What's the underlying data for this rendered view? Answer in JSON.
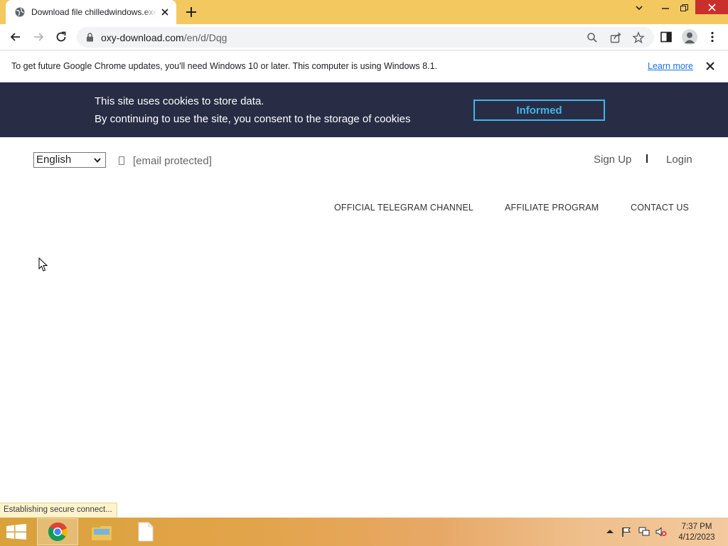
{
  "browser": {
    "tab_title": "Download file chilledwindows.exe",
    "url_host": "oxy-download.com",
    "url_path": "/en/d/Dqg"
  },
  "infobar": {
    "message": "To get future Google Chrome updates, you'll need Windows 10 or later. This computer is using Windows 8.1.",
    "link": "Learn more"
  },
  "cookie": {
    "line1": "This site uses cookies to store data.",
    "line2": "By continuing to use the site, you consent to the storage of cookies",
    "button": "Informed"
  },
  "header": {
    "language": "English",
    "email": "[email protected]",
    "signup": "Sign Up",
    "separator": "I",
    "login": "Login"
  },
  "nav": {
    "items": [
      "OFFICIAL TELEGRAM CHANNEL",
      "AFFILIATE PROGRAM",
      "CONTACT US"
    ]
  },
  "status": {
    "text": "Establishing secure connect..."
  },
  "taskbar": {
    "time": "7:37 PM",
    "date": "4/12/2023"
  },
  "colors": {
    "titlebar": "#f3c85f",
    "cookie_bg": "#282d45",
    "cookie_accent": "#3fb6e8",
    "link_blue": "#1a73e8"
  }
}
